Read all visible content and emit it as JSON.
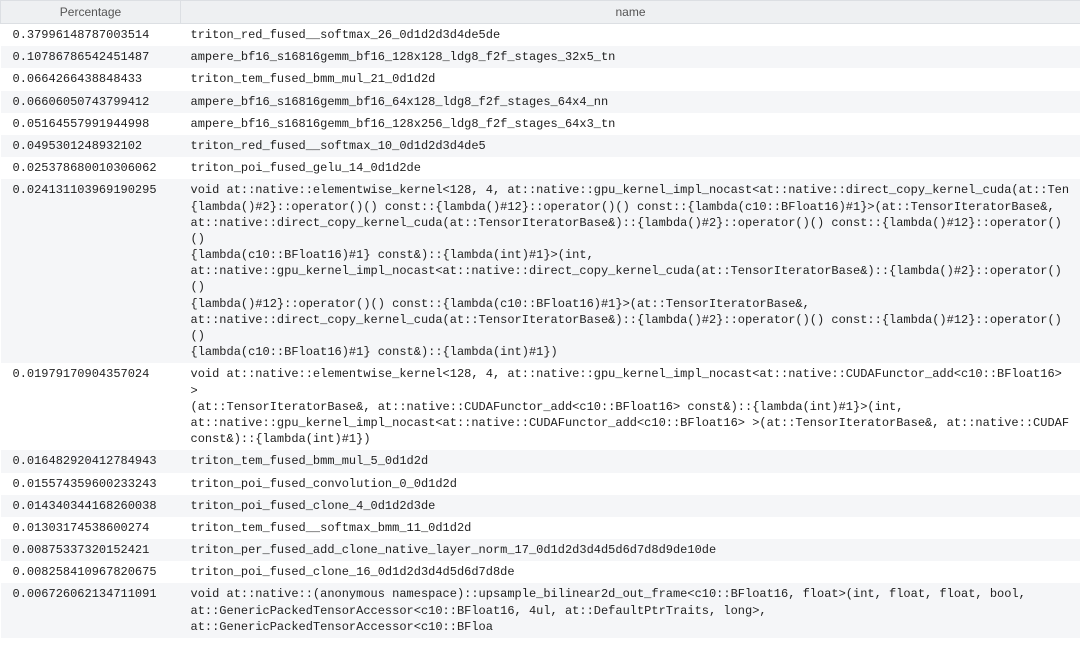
{
  "columns": {
    "pct": "Percentage",
    "name": "name"
  },
  "rows": [
    {
      "pct": "0.37996148787003514",
      "name": "triton_red_fused__softmax_26_0d1d2d3d4de5de"
    },
    {
      "pct": "0.10786786542451487",
      "name": "ampere_bf16_s16816gemm_bf16_128x128_ldg8_f2f_stages_32x5_tn"
    },
    {
      "pct": "0.0664266438848433",
      "name": "triton_tem_fused_bmm_mul_21_0d1d2d"
    },
    {
      "pct": "0.06606050743799412",
      "name": "ampere_bf16_s16816gemm_bf16_64x128_ldg8_f2f_stages_64x4_nn"
    },
    {
      "pct": "0.05164557991944998",
      "name": "ampere_bf16_s16816gemm_bf16_128x256_ldg8_f2f_stages_64x3_tn"
    },
    {
      "pct": "0.0495301248932102",
      "name": "triton_red_fused__softmax_10_0d1d2d3d4de5"
    },
    {
      "pct": "0.025378680010306062",
      "name": "triton_poi_fused_gelu_14_0d1d2de"
    },
    {
      "pct": "0.024131103969190295",
      "name": "void at::native::elementwise_kernel<128, 4, at::native::gpu_kernel_impl_nocast<at::native::direct_copy_kernel_cuda(at::Ten\n{lambda()#2}::operator()() const::{lambda()#12}::operator()() const::{lambda(c10::BFloat16)#1}>(at::TensorIteratorBase&,\nat::native::direct_copy_kernel_cuda(at::TensorIteratorBase&)::{lambda()#2}::operator()() const::{lambda()#12}::operator()()\n{lambda(c10::BFloat16)#1} const&)::{lambda(int)#1}>(int,\nat::native::gpu_kernel_impl_nocast<at::native::direct_copy_kernel_cuda(at::TensorIteratorBase&)::{lambda()#2}::operator()()\n{lambda()#12}::operator()() const::{lambda(c10::BFloat16)#1}>(at::TensorIteratorBase&,\nat::native::direct_copy_kernel_cuda(at::TensorIteratorBase&)::{lambda()#2}::operator()() const::{lambda()#12}::operator()()\n{lambda(c10::BFloat16)#1} const&)::{lambda(int)#1})"
    },
    {
      "pct": "0.01979170904357024",
      "name": "void at::native::elementwise_kernel<128, 4, at::native::gpu_kernel_impl_nocast<at::native::CUDAFunctor_add<c10::BFloat16> >\n(at::TensorIteratorBase&, at::native::CUDAFunctor_add<c10::BFloat16> const&)::{lambda(int)#1}>(int,\nat::native::gpu_kernel_impl_nocast<at::native::CUDAFunctor_add<c10::BFloat16> >(at::TensorIteratorBase&, at::native::CUDAF\nconst&)::{lambda(int)#1})"
    },
    {
      "pct": "0.016482920412784943",
      "name": "triton_tem_fused_bmm_mul_5_0d1d2d"
    },
    {
      "pct": "0.015574359600233243",
      "name": "triton_poi_fused_convolution_0_0d1d2d"
    },
    {
      "pct": "0.014340344168260038",
      "name": "triton_poi_fused_clone_4_0d1d2d3de"
    },
    {
      "pct": "0.01303174538600274",
      "name": "triton_tem_fused__softmax_bmm_11_0d1d2d"
    },
    {
      "pct": "0.00875337320152421",
      "name": "triton_per_fused_add_clone_native_layer_norm_17_0d1d2d3d4d5d6d7d8d9de10de"
    },
    {
      "pct": "0.008258410967820675",
      "name": "triton_poi_fused_clone_16_0d1d2d3d4d5d6d7d8de"
    },
    {
      "pct": "0.006726062134711091",
      "name": "void at::native::(anonymous namespace)::upsample_bilinear2d_out_frame<c10::BFloat16, float>(int, float, float, bool,\nat::GenericPackedTensorAccessor<c10::BFloat16, 4ul, at::DefaultPtrTraits, long>, at::GenericPackedTensorAccessor<c10::BFloa"
    }
  ]
}
